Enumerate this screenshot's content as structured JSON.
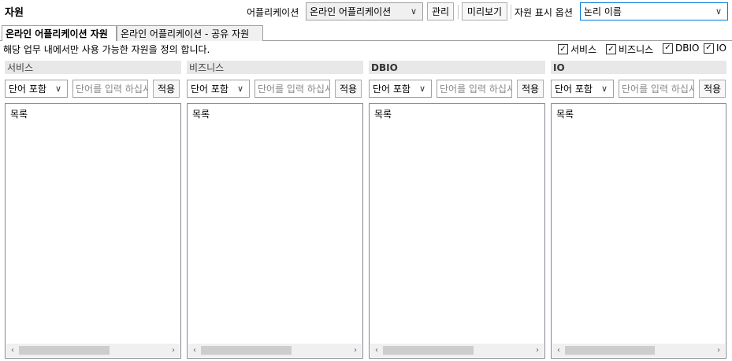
{
  "header": {
    "title": "자원",
    "app_label": "어플리케이션",
    "app_value": "온라인 어플리케이션",
    "manage_label": "관리",
    "preview_label": "미리보기",
    "display_option_label": "자원 표시 옵션",
    "display_option_value": "논리 이름"
  },
  "tabs": [
    {
      "label": "온라인 어플리케이션 자원",
      "active": true
    },
    {
      "label": "온라인 어플리케이션 - 공유 자원",
      "active": false
    }
  ],
  "description": "해당 업무 내에서만 사용 가능한 자원을 정의 합니다.",
  "filters": [
    {
      "label": "서비스",
      "checked": true
    },
    {
      "label": "비즈니스",
      "checked": true
    },
    {
      "label": "DBIO",
      "checked": true
    },
    {
      "label": "IO",
      "checked": true
    }
  ],
  "panels": [
    {
      "title": "서비스",
      "match_mode": "단어 포함",
      "search_placeholder": "단어를 입력 하십시오",
      "apply_label": "적용",
      "list_header": "목록"
    },
    {
      "title": "비즈니스",
      "match_mode": "단어 포함",
      "search_placeholder": "단어를 입력 하십시오",
      "apply_label": "적용",
      "list_header": "목록"
    },
    {
      "title": "DBIO",
      "match_mode": "단어 포함",
      "search_placeholder": "단어를 입력 하십시오",
      "apply_label": "적용",
      "list_header": "목록"
    },
    {
      "title": "IO",
      "match_mode": "단어 포함",
      "search_placeholder": "단어를 입력 하십시오",
      "apply_label": "적용",
      "list_header": "목록"
    }
  ],
  "icons": {
    "dropdown": "chevron-down-icon",
    "check": "check-icon",
    "scroll_left": "arrow-left-icon",
    "scroll_right": "arrow-right-icon"
  }
}
